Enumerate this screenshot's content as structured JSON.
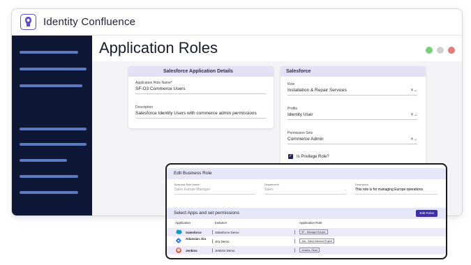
{
  "app": {
    "title": "Identity Confluence"
  },
  "page": {
    "title": "Application Roles"
  },
  "window_controls": {
    "colors": [
      "#7ccf7a",
      "#d0d0d0",
      "#e07c7c"
    ]
  },
  "sidebar": {
    "item_count": 11
  },
  "details_card": {
    "title": "Salesforce Application Details",
    "name_label": "Application Role Name*",
    "name_value": "SF-O3 Commerce Users",
    "desc_label": "Description",
    "desc_value": "Salesforce Identity Users with commerce admin permissions"
  },
  "salesforce_card": {
    "title": "Salesforce",
    "role_label": "Role",
    "role_value": "Installation & Repair Services",
    "profile_label": "Profile",
    "profile_value": "Identity User",
    "perm_label": "Permission Sets",
    "perm_value": "Commerce Admin",
    "privilege_label": "Is Privilege Role?",
    "privilege_checked": true
  },
  "modal": {
    "title": "Edit Business Role",
    "brn_label": "Business Role Name*",
    "brn_value": "Sales Europe Manager",
    "dept_label": "Department*",
    "dept_value": "Sales",
    "desc_label": "Description",
    "desc_value": "This role is for managing Europe operations",
    "apps_title": "Select Apps and set permissions",
    "edit_roles_label": "Edit Roles",
    "columns": [
      "Application",
      "Instance",
      "Application Role"
    ],
    "rows": [
      {
        "app": "Salesforce",
        "instance": "Salesforce Demo",
        "role": "SF - Manager Europe",
        "icon": "salesforce-cloud-icon"
      },
      {
        "app": "Atlassian Jira",
        "instance": "Jira Demo",
        "role": "Jira - Sales Inbound Project",
        "icon": "jira-icon"
      },
      {
        "app": "Jenkins",
        "instance": "Jenkins Demo",
        "role": "Jenkins- Read",
        "icon": "jenkins-icon"
      }
    ]
  },
  "colors": {
    "sidebar_bg": "#0f1737",
    "accent": "#3f2ea9",
    "card_header": "#e4e1f7"
  }
}
